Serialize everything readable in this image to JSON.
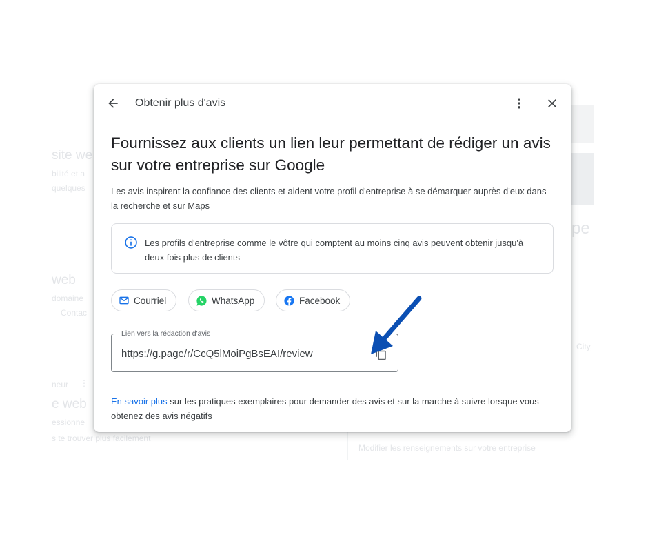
{
  "background": {
    "left": [
      "site we",
      "bilité et a",
      "quelques",
      "web",
      "domaine",
      "Contac",
      "neur",
      "e web",
      "essionne",
      "s te trouver plus facilement"
    ],
    "right": [
      "pe",
      "City,",
      "Modifier les renseignements sur votre entreprise"
    ],
    "menu_glyph": "⋮"
  },
  "dialog": {
    "title": "Obtenir plus d'avis",
    "heading": "Fournissez aux clients un lien leur permettant de rédiger un avis sur votre entreprise sur Google",
    "description": "Les avis inspirent la confiance des clients et aident votre profil d'entreprise à se démarquer auprès d'eux dans la recherche et sur Maps",
    "info": "Les profils d'entreprise comme le vôtre qui comptent au moins cinq avis peuvent obtenir jusqu'à deux fois plus de clients",
    "share_buttons": [
      {
        "label": "Courriel",
        "icon": "email-icon"
      },
      {
        "label": "WhatsApp",
        "icon": "whatsapp-icon"
      },
      {
        "label": "Facebook",
        "icon": "facebook-icon"
      }
    ],
    "link_field": {
      "label": "Lien vers la rédaction d'avis",
      "value": "https://g.page/r/CcQ5lMoiPgBsEAI/review"
    },
    "footer": {
      "link_text": "En savoir plus",
      "text": " sur les pratiques exemplaires pour demander des avis et sur la marche à suivre lorsque vous obtenez des avis négatifs"
    }
  },
  "colors": {
    "link": "#1a73e8",
    "annotation_arrow": "#0b4fb3",
    "whatsapp": "#25d366",
    "facebook": "#1877f2"
  }
}
